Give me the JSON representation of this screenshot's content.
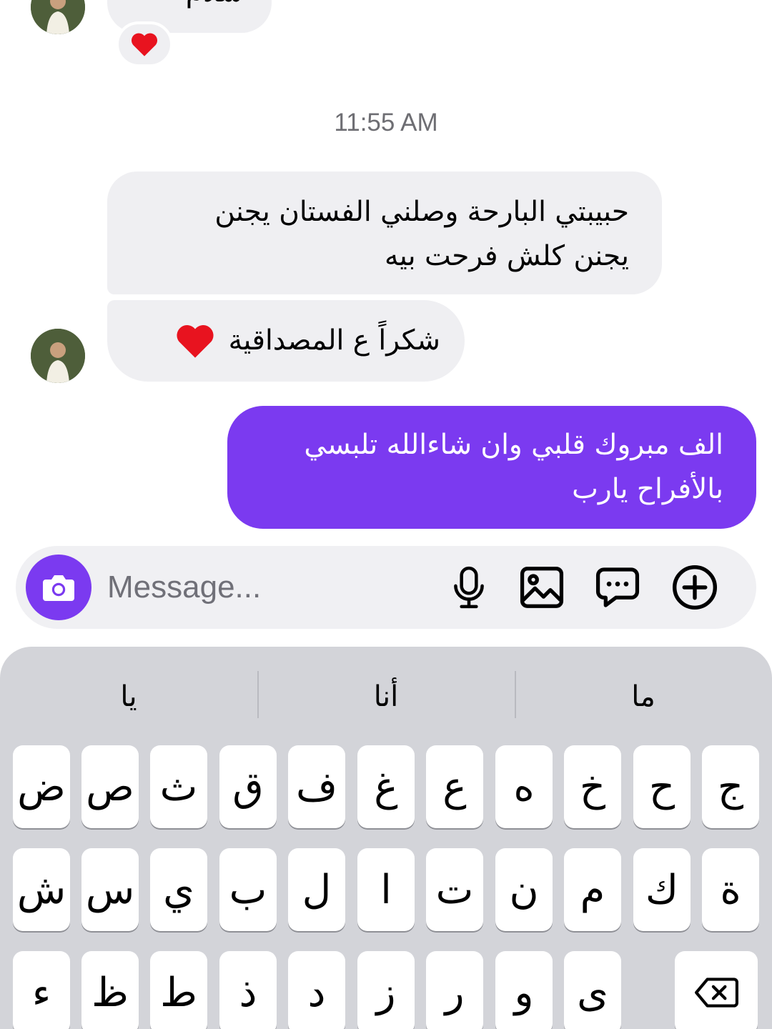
{
  "conversation": {
    "top_partial_text": "سلام",
    "top_reaction": "❤️",
    "timestamp": "11:55 AM",
    "incoming": [
      {
        "line1": "حبيبتي البارحة وصلني الفستان يجنن",
        "line2": "يجنن كلش فرحت بيه"
      },
      {
        "text": "شكراً ع المصداقية",
        "emoji": "❤️"
      }
    ],
    "outgoing": [
      {
        "line1": "الف مبروك قلبي وان شاءالله تلبسي",
        "line2": "بالأفراح يارب"
      }
    ]
  },
  "composer": {
    "placeholder": "Message...",
    "icons": [
      "camera-icon",
      "microphone-icon",
      "image-icon",
      "chat-sticker-icon",
      "plus-icon"
    ],
    "accent": "#7b3af0"
  },
  "keyboard": {
    "suggestions": [
      "يا",
      "أنا",
      "ما"
    ],
    "row1": [
      "ض",
      "ص",
      "ث",
      "ق",
      "ف",
      "غ",
      "ع",
      "ه",
      "خ",
      "ح",
      "ج"
    ],
    "row2": [
      "ش",
      "س",
      "ي",
      "ب",
      "ل",
      "ا",
      "ت",
      "ن",
      "م",
      "ك",
      "ة"
    ],
    "row3": [
      "ء",
      "ظ",
      "ط",
      "ذ",
      "د",
      "ز",
      "ر",
      "و",
      "ى"
    ],
    "delete_icon": "backspace-icon"
  }
}
